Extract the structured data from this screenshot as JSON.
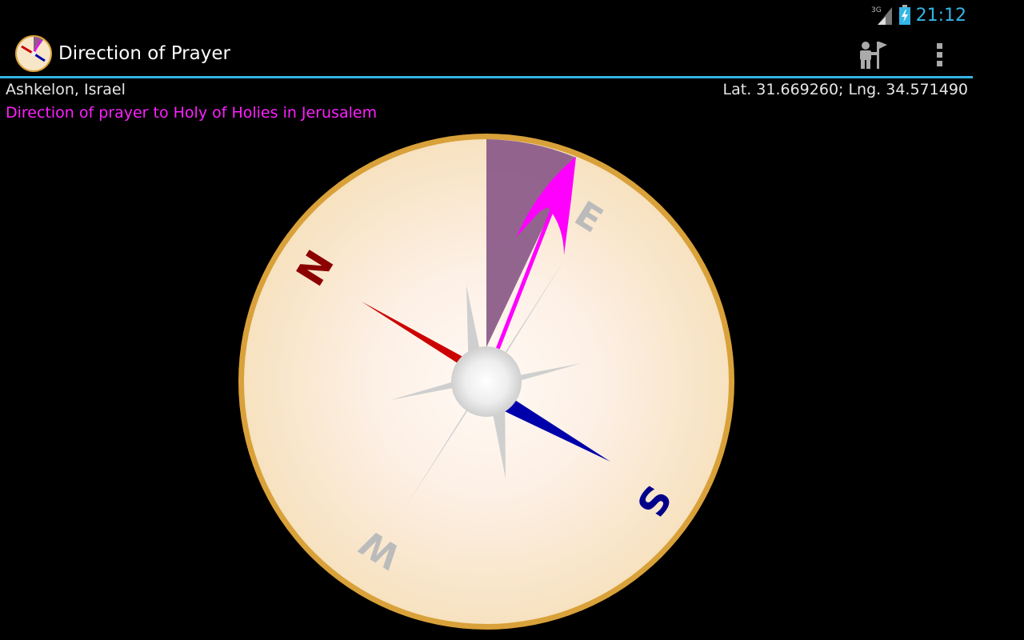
{
  "status_bar": {
    "network": "3G",
    "time": "21:12"
  },
  "action_bar": {
    "title": "Direction of Prayer",
    "location_action": "person-with-flag-icon",
    "overflow_action": "overflow-menu-icon"
  },
  "info": {
    "location": "Ashkelon, Israel",
    "coordinates": "Lat. 31.669260; Lng. 34.571490",
    "direction_text": "Direction of prayer to Holy of Holies in Jerusalem"
  },
  "compass": {
    "labels": {
      "north": "N",
      "east": "E",
      "south": "S",
      "west": "W"
    },
    "colors": {
      "north_needle": "#cc0000",
      "south_needle": "#0000aa",
      "prayer_arrow": "#ff00ff",
      "rim": "#d9a13a",
      "face": "#fbe9cf",
      "sector": "#8c5d8a"
    }
  },
  "colors": {
    "accent": "#33b5e5",
    "direction_text": "#ff20ff"
  }
}
